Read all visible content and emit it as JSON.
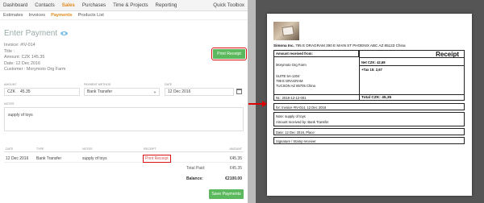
{
  "topnav": {
    "items": [
      "Dashboard",
      "Contacts",
      "Sales",
      "Purchases",
      "Time & Projects",
      "Reporting"
    ],
    "active_index": 2,
    "right_label": "Quick Toolbox"
  },
  "subnav": {
    "items": [
      "Estimates",
      "Invoices",
      "Payments",
      "Products List"
    ],
    "active_index": 2
  },
  "page": {
    "title": "Enter Payment",
    "info": {
      "invoice": "Invoice: #IV-014",
      "title": "Title :",
      "amount": "Amount: CZK 145.35",
      "date": "Date: 12 Dec 2016",
      "customer": "Customer : Morymoto Org Farm"
    },
    "print_receipt_label": "Print Receipt"
  },
  "form": {
    "amount_label": "AMOUNT",
    "currency": "CZK",
    "amount_value": "45.35",
    "method_label": "PAYMENT METHOD",
    "method_value": "Bank Transfer",
    "date_label": "DATE",
    "date_value": "12 Dec 2016",
    "notes_label": "NOTES",
    "notes_value": "supply of toys"
  },
  "table": {
    "headers": [
      "DATE",
      "TYPE",
      "NOTES",
      "RECEIPT",
      "AMOUNT"
    ],
    "row": {
      "date": "12 Dec 2016",
      "type": "Bank Transfer",
      "notes": "supply of toys",
      "receipt": "Print Receipt",
      "amount": "€45.35"
    },
    "total_paid_label": "Total Paid:",
    "total_paid_value": "€45.35",
    "balance_label": "Balance:",
    "balance_value": "€2100.00",
    "save_label": "Save Payments"
  },
  "receipt": {
    "company_name": "Simona Inc.",
    "company_address": "795 E DRAGRAM 290 E MAIN ST PHOENIX ABC AZ 85123 China",
    "received_from_label": "Amount received from:",
    "title": "Receipt",
    "customer_lines": [
      "Morymoto Org Farm",
      "SUITE 5A-1204",
      "799 E DRAGRAM",
      "TUCSON AZ 85705 China"
    ],
    "net": "Net CZK: 42,68",
    "tax": "+Tax 15: 2,67",
    "nr": "Nr.: 2016-12-12-001",
    "total": "Total CZK: 45,35",
    "for_invoice": "for: Invoice #IV-014, 12 Dec 2016",
    "note": "Note: supply of toys",
    "received_by": "Amount received by: Bank Transfer",
    "date_place": "Date: 12 Dec 2016, Place:",
    "signature": "Signature / Stamp receiver"
  },
  "colors": {
    "accent_orange": "#e08a1e",
    "button_green": "#5cb85c",
    "highlight_red": "#dd1111"
  }
}
